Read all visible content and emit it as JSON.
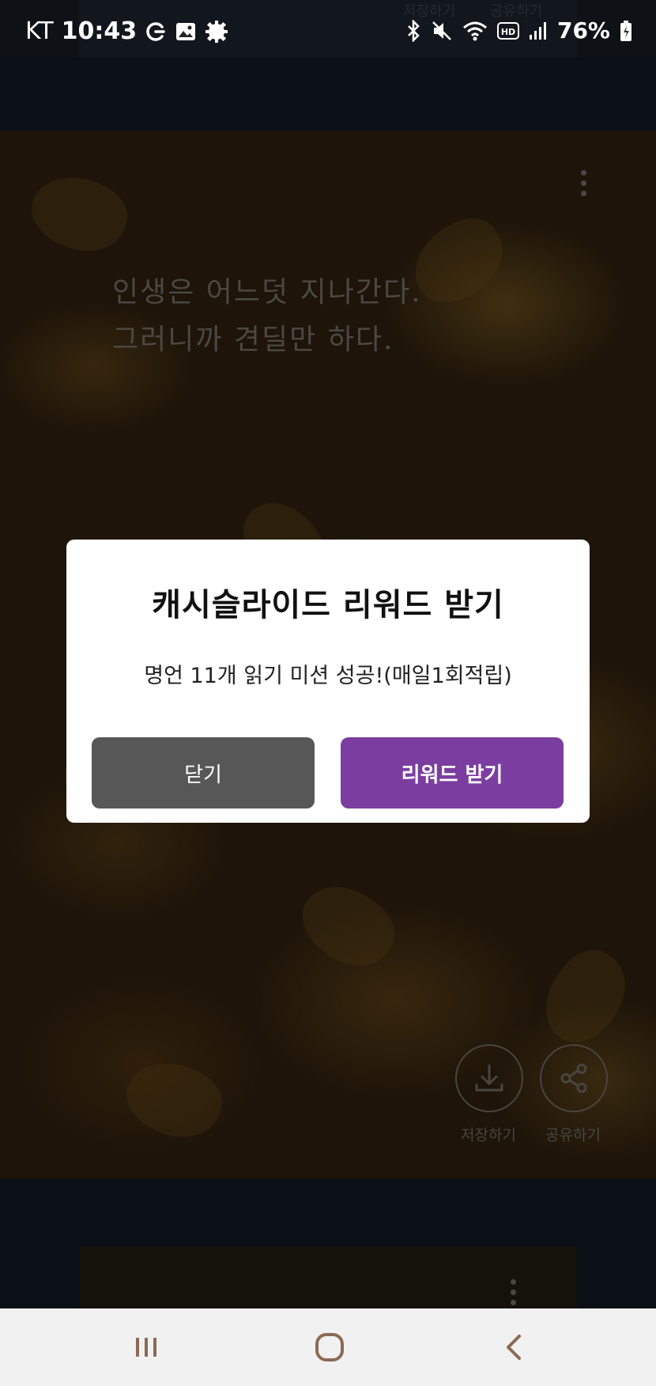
{
  "status_bar": {
    "carrier": "KT",
    "time": "10:43",
    "battery": "76%",
    "icons_left": [
      "g-pay-icon",
      "gallery-icon",
      "settings-gear-icon"
    ],
    "icons_right": [
      "bluetooth-icon",
      "mute-icon",
      "wifi-icon",
      "hd-icon",
      "signal-icon",
      "battery-icon"
    ]
  },
  "feed": {
    "top_card": {
      "save_label": "저장하기",
      "share_label": "공유하기"
    },
    "quote_card": {
      "quote": "인생은 어느덧 지나간다.\n그러니까 견딜만 하다.",
      "save_label": "저장하기",
      "share_label": "공유하기"
    }
  },
  "dialog": {
    "title": "캐시슬라이드 리워드 받기",
    "message": "명언 11개 읽기 미션 성공!(매일1회적립)",
    "close_label": "닫기",
    "reward_label": "리워드 받기",
    "reward_color": "#7b3ea0",
    "close_color": "#575757"
  },
  "nav_bar": {
    "icons": [
      "recent-apps-icon",
      "home-icon",
      "back-icon"
    ]
  }
}
